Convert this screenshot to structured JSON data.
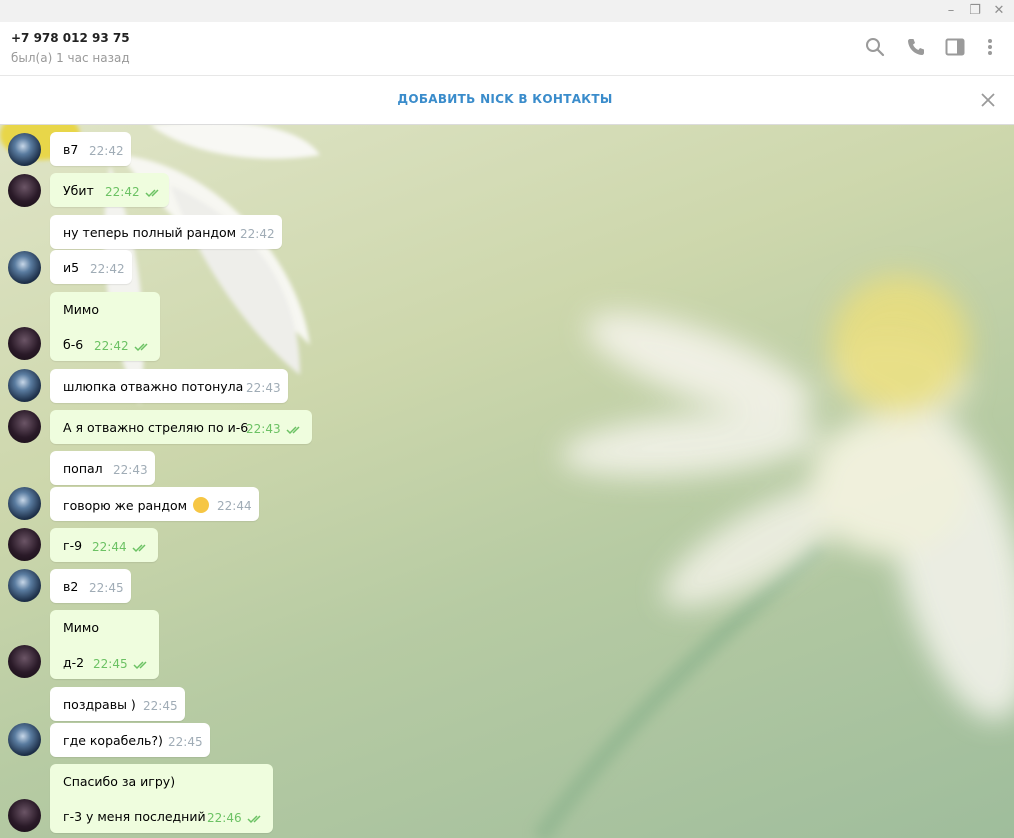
{
  "window": {
    "minimize_glyph": "–",
    "maximize_glyph": "❐",
    "close_glyph": "✕"
  },
  "header": {
    "peer_name": "+7 978 012 93 75",
    "peer_status": "был(а) 1 час назад",
    "icons": [
      "search-icon",
      "phone-icon",
      "sidebar-toggle-icon",
      "more-vertical-icon"
    ]
  },
  "banner": {
    "text": "ДОБАВИТЬ NICK В КОНТАКТЫ",
    "close_icon": "close-icon"
  },
  "colors": {
    "accent": "#3a8ccb",
    "outgoing_bubble": "#effdde",
    "incoming_bubble": "#ffffff",
    "read_check": "#6cc264",
    "time_gray": "#a0acb6"
  },
  "messages": [
    {
      "dir": "in",
      "text": "в7",
      "time": "22:42"
    },
    {
      "dir": "out",
      "text": "Убит",
      "time": "22:42"
    },
    {
      "dir": "in",
      "text": "ну теперь полный рандом",
      "time": "22:42"
    },
    {
      "dir": "in",
      "text": "и5",
      "time": "22:42"
    },
    {
      "dir": "out",
      "text": "Мимо",
      "text2": "б-6",
      "time": "22:42"
    },
    {
      "dir": "in",
      "text": "шлюпка отважно потонула",
      "time": "22:43"
    },
    {
      "dir": "out",
      "text": "А я отважно стреляю по и-6",
      "time": "22:43"
    },
    {
      "dir": "in",
      "text": "попал",
      "time": "22:43"
    },
    {
      "dir": "in",
      "text": "говорю же рандом",
      "emoji": "laughing-tears-emoji",
      "time": "22:44"
    },
    {
      "dir": "out",
      "text": "г-9",
      "time": "22:44"
    },
    {
      "dir": "in",
      "text": "в2",
      "time": "22:45"
    },
    {
      "dir": "out",
      "text": "Мимо",
      "text2": "д-2",
      "time": "22:45"
    },
    {
      "dir": "in",
      "text": "поздравы )",
      "time": "22:45"
    },
    {
      "dir": "in",
      "text": "где корабель?)",
      "time": "22:45"
    },
    {
      "dir": "out",
      "text": "Спасибо за игру)",
      "text2": "г-3 у меня последний",
      "time": "22:46"
    }
  ]
}
